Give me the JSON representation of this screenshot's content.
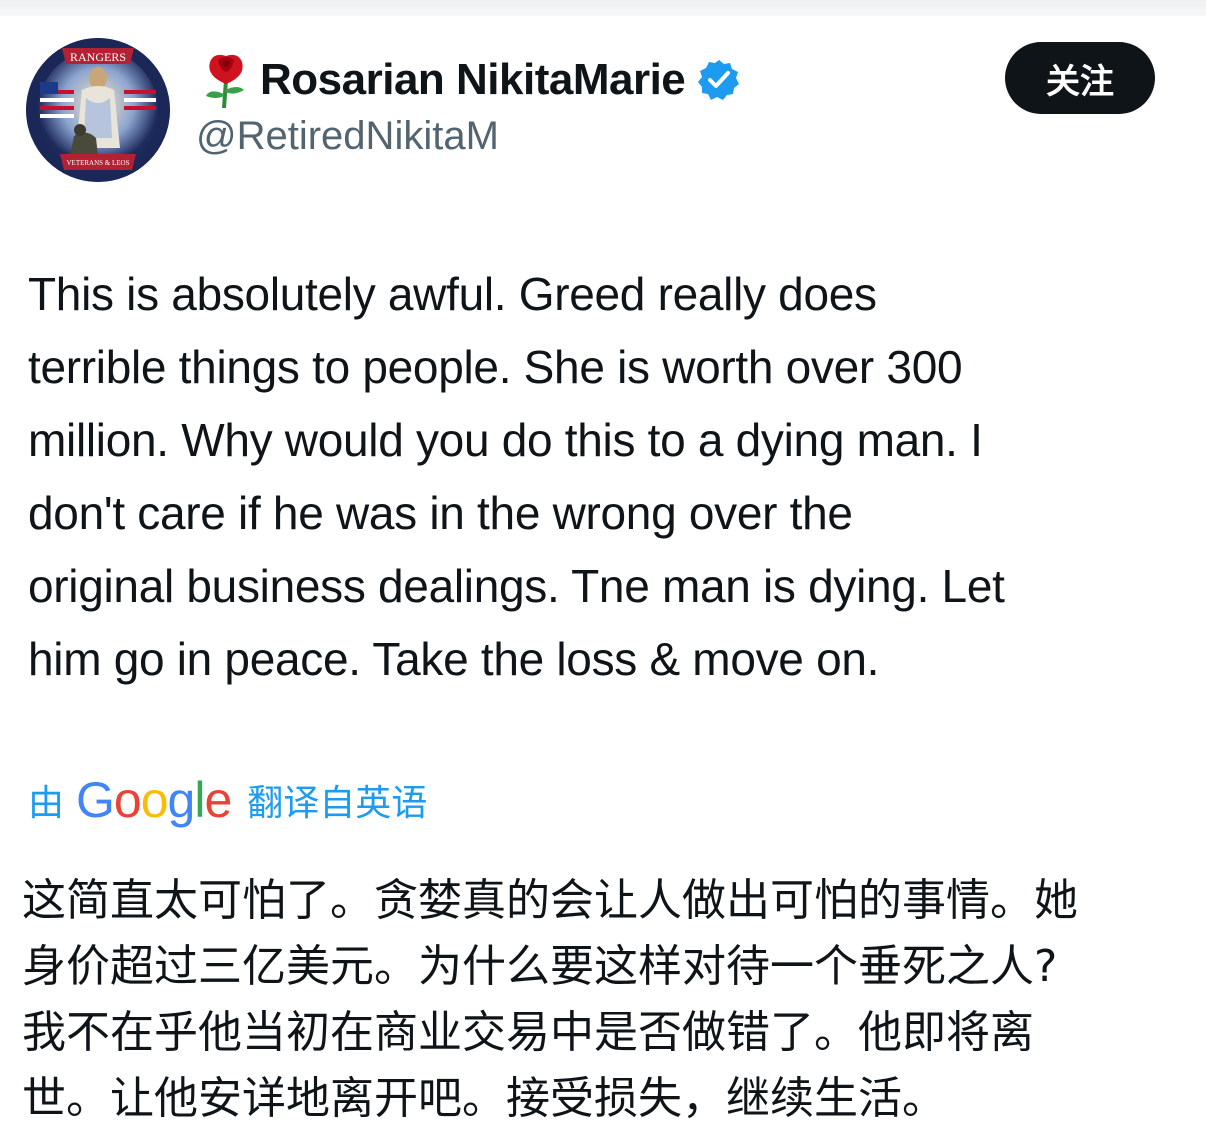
{
  "author": {
    "display_name": "Rosarian NikitaMarie",
    "handle": "@RetiredNikitaM",
    "name_emoji": "rose-icon",
    "verified_badge": "verified-badge-icon",
    "avatar_texts": {
      "banner_top": "RANGERS",
      "banner_bottom": "VETERANS & LEOS"
    }
  },
  "actions": {
    "follow_label": "关注"
  },
  "tweet": {
    "text": "This is absolutely awful. Greed really does\nterrible things to people. She is worth over 300\nmillion. Why would you do this to a dying man. I\ndon't care if he was in the wrong over the\noriginal business dealings. Tne man is dying. Let\nhim go in peace. Take the loss & move on."
  },
  "translation": {
    "by_label": "由",
    "provider": "Google",
    "from_label": "翻译自英语",
    "text": "这简直太可怕了。贪婪真的会让人做出可怕的事情。她\n身价超过三亿美元。为什么要这样对待一个垂死之人?\n我不在乎他当初在商业交易中是否做错了。他即将离\n世。让他安详地离开吧。接受损失，继续生活。"
  },
  "colors": {
    "accent_blue": "#1d9bf0",
    "text_primary": "#0f1419",
    "text_secondary": "#536471",
    "button_bg": "#0f1419"
  }
}
